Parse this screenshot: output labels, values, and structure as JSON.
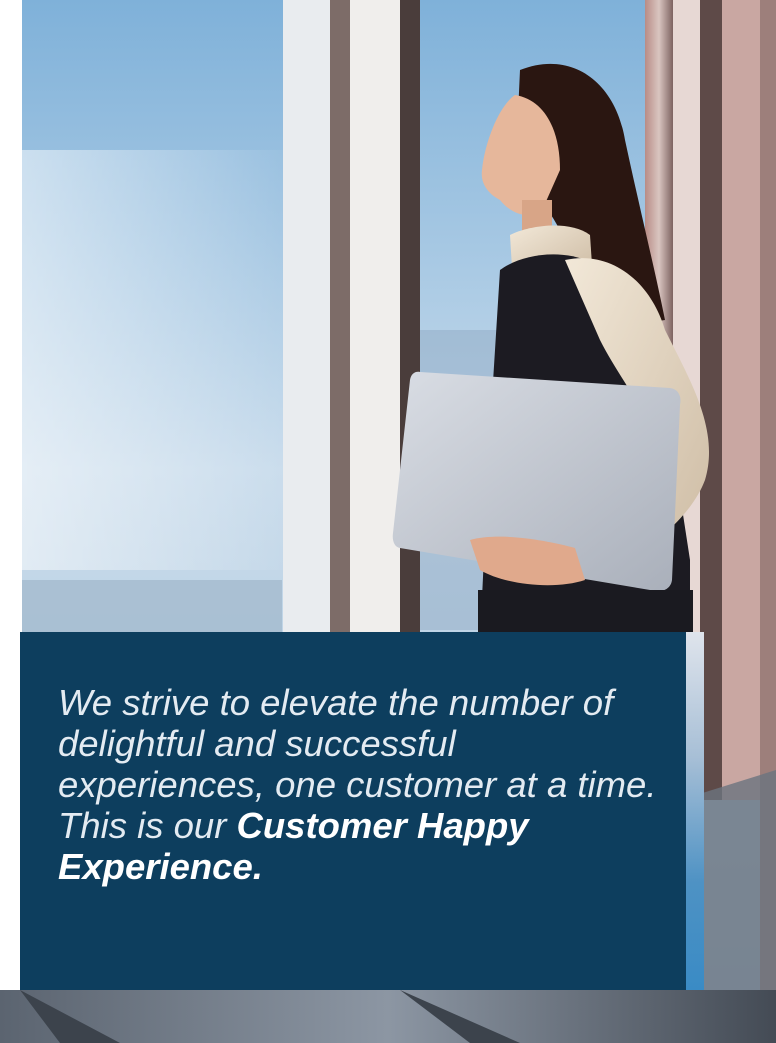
{
  "quote": {
    "lead": "We strive to elevate the number of delightful and successful experiences, one customer at a time. This is our ",
    "emphasis": "Customer Happy Experience."
  },
  "colors": {
    "panel": "#0d3e5e",
    "accent": "#3a8bc5",
    "text": "#e3ebf2"
  },
  "photo": {
    "subject": "woman holding laptop looking out office window"
  }
}
